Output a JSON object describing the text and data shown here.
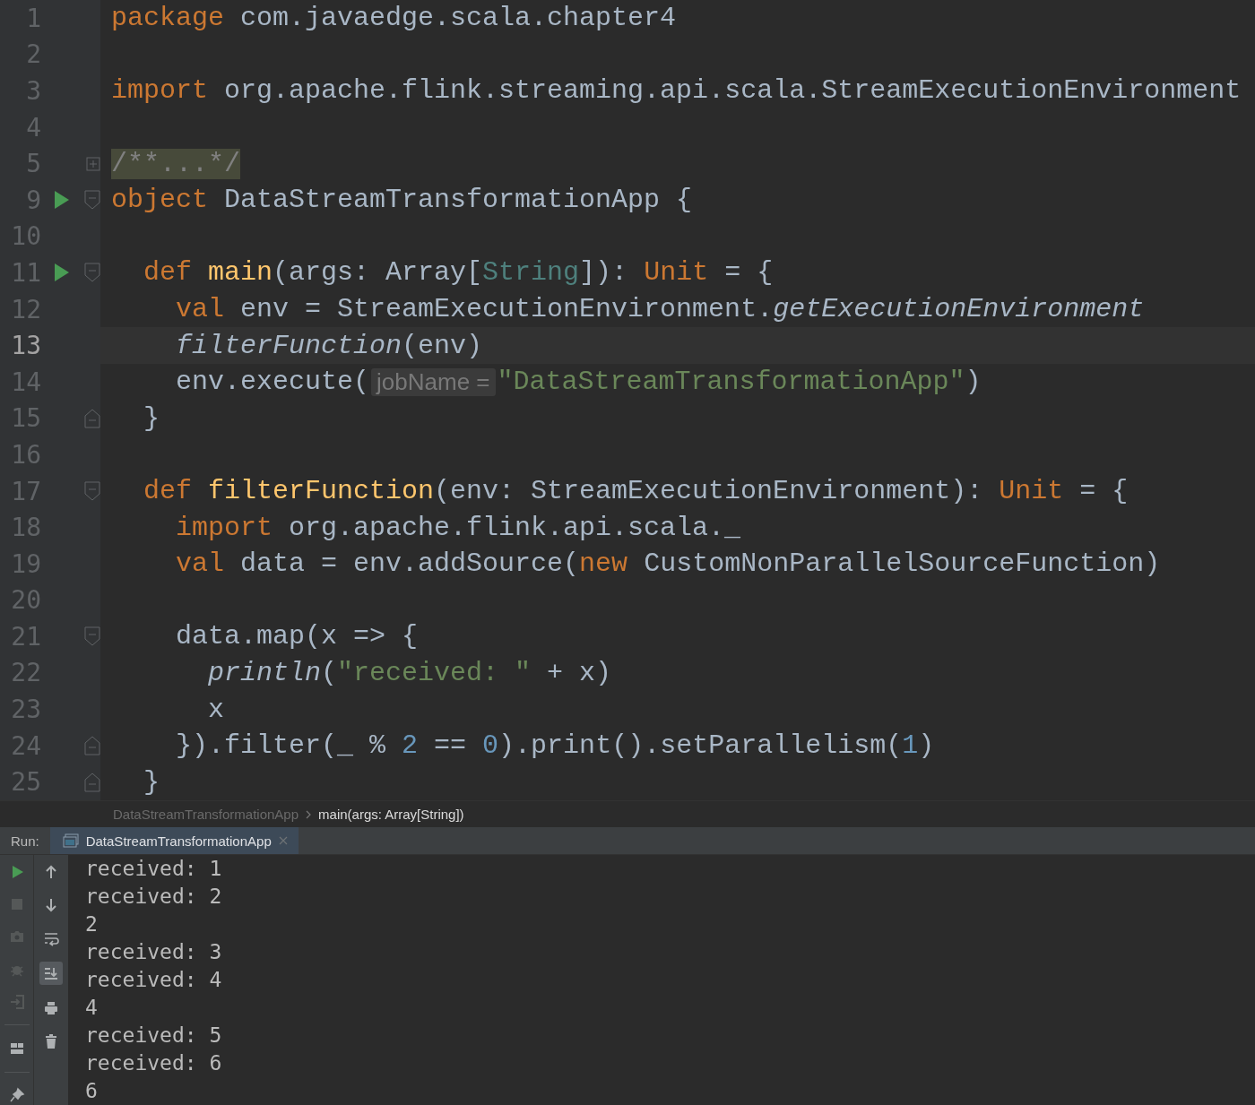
{
  "editor": {
    "lines": [
      {
        "number": "1",
        "run": false,
        "current": false,
        "tokens": [
          {
            "kind": "kw",
            "text": "package"
          },
          {
            "kind": "plain",
            "text": " com.javaedge.scala.chapter4"
          }
        ]
      },
      {
        "number": "2",
        "run": false,
        "current": false
      },
      {
        "number": "3",
        "run": false,
        "current": false,
        "tokens": [
          {
            "kind": "kw",
            "text": "import"
          },
          {
            "kind": "plain",
            "text": " org.apache.flink.streaming.api.scala.StreamExecutionEnvironment"
          }
        ]
      },
      {
        "number": "4",
        "run": false,
        "current": false
      },
      {
        "number": "5",
        "run": false,
        "current": false,
        "fold": {
          "kind": "collapsed"
        },
        "tokens": [
          {
            "kind": "folded",
            "text": "/**...*/"
          }
        ]
      },
      {
        "number": "9",
        "run": true,
        "current": false,
        "fold": {
          "kind": "start"
        },
        "tokens": [
          {
            "kind": "kw",
            "text": "object"
          },
          {
            "kind": "plain",
            "text": " DataStreamTransformationApp {"
          }
        ]
      },
      {
        "number": "10",
        "run": false,
        "current": false
      },
      {
        "number": "11",
        "run": true,
        "current": false,
        "fold": {
          "kind": "start"
        },
        "tokens": [
          {
            "kind": "kw",
            "text": "  def"
          },
          {
            "kind": "fn",
            "text": " main"
          },
          {
            "kind": "plain",
            "text": "(args: Array["
          },
          {
            "kind": "type",
            "text": "String"
          },
          {
            "kind": "plain",
            "text": "]): "
          },
          {
            "kind": "kw",
            "text": "Unit"
          },
          {
            "kind": "plain",
            "text": " = {"
          }
        ]
      },
      {
        "number": "12",
        "run": false,
        "current": false,
        "tokens": [
          {
            "kind": "kw",
            "text": "    val"
          },
          {
            "kind": "plain",
            "text": " env = StreamExecutionEnvironment."
          },
          {
            "kind": "italic",
            "text": "getExecutionEnvironment"
          }
        ]
      },
      {
        "number": "13",
        "run": false,
        "current": true,
        "tokens": [
          {
            "kind": "italic",
            "text": "    filterFunction"
          },
          {
            "kind": "plain",
            "text": "(env)"
          }
        ]
      },
      {
        "number": "14",
        "run": false,
        "current": false,
        "tokens": [
          {
            "kind": "plain",
            "text": "    env.execute("
          },
          {
            "kind": "hint",
            "text": "jobName ="
          },
          {
            "kind": "str",
            "text": "\"DataStreamTransformationApp\""
          },
          {
            "kind": "plain",
            "text": ")"
          }
        ]
      },
      {
        "number": "15",
        "run": false,
        "current": false,
        "fold": {
          "kind": "end"
        },
        "tokens": [
          {
            "kind": "plain",
            "text": "  }"
          }
        ]
      },
      {
        "number": "16",
        "run": false,
        "current": false
      },
      {
        "number": "17",
        "run": false,
        "current": false,
        "fold": {
          "kind": "start"
        },
        "tokens": [
          {
            "kind": "kw",
            "text": "  def"
          },
          {
            "kind": "fn",
            "text": " filterFunction"
          },
          {
            "kind": "plain",
            "text": "(env: StreamExecutionEnvironment): "
          },
          {
            "kind": "kw",
            "text": "Unit"
          },
          {
            "kind": "plain",
            "text": " = {"
          }
        ]
      },
      {
        "number": "18",
        "run": false,
        "current": false,
        "tokens": [
          {
            "kind": "kw",
            "text": "    import"
          },
          {
            "kind": "plain",
            "text": " org.apache.flink.api.scala._"
          }
        ]
      },
      {
        "number": "19",
        "run": false,
        "current": false,
        "tokens": [
          {
            "kind": "kw",
            "text": "    val"
          },
          {
            "kind": "plain",
            "text": " data = env.addSource("
          },
          {
            "kind": "kw",
            "text": "new"
          },
          {
            "kind": "plain",
            "text": " CustomNonParallelSourceFunction)"
          }
        ]
      },
      {
        "number": "20",
        "run": false,
        "current": false
      },
      {
        "number": "21",
        "run": false,
        "current": false,
        "fold": {
          "kind": "start"
        },
        "tokens": [
          {
            "kind": "plain",
            "text": "    data.map(x => {"
          }
        ]
      },
      {
        "number": "22",
        "run": false,
        "current": false,
        "tokens": [
          {
            "kind": "italic",
            "text": "      println"
          },
          {
            "kind": "plain",
            "text": "("
          },
          {
            "kind": "str",
            "text": "\"received: \""
          },
          {
            "kind": "plain",
            "text": " + x)"
          }
        ]
      },
      {
        "number": "23",
        "run": false,
        "current": false,
        "tokens": [
          {
            "kind": "plain",
            "text": "      x"
          }
        ]
      },
      {
        "number": "24",
        "run": false,
        "current": false,
        "fold": {
          "kind": "end"
        },
        "tokens": [
          {
            "kind": "plain",
            "text": "    }).filter(_ % "
          },
          {
            "kind": "num",
            "text": "2"
          },
          {
            "kind": "plain",
            "text": " == "
          },
          {
            "kind": "num",
            "text": "0"
          },
          {
            "kind": "plain",
            "text": ").print().setParallelism("
          },
          {
            "kind": "num",
            "text": "1"
          },
          {
            "kind": "plain",
            "text": ")"
          }
        ]
      },
      {
        "number": "25",
        "run": false,
        "current": false,
        "fold": {
          "kind": "end"
        },
        "tokens": [
          {
            "kind": "plain",
            "text": "  }"
          }
        ]
      }
    ]
  },
  "breadcrumbs": [
    {
      "label": "DataStreamTransformationApp",
      "selected": false
    },
    {
      "label": "main(args: Array[String])",
      "selected": true
    }
  ],
  "run_panel": {
    "label": "Run:",
    "tab": {
      "title": "DataStreamTransformationApp",
      "selected": true
    },
    "left_toolbar": [
      {
        "kind": "run",
        "disabled": false
      },
      {
        "kind": "stop",
        "disabled": true
      },
      {
        "kind": "camera",
        "disabled": true
      },
      {
        "kind": "bug",
        "disabled": true
      },
      {
        "kind": "exit",
        "disabled": true
      },
      {
        "kind": "separator"
      },
      {
        "kind": "layout",
        "disabled": false
      },
      {
        "kind": "separator"
      },
      {
        "kind": "pin",
        "disabled": false
      }
    ],
    "right_toolbar": [
      {
        "kind": "up",
        "selected": false
      },
      {
        "kind": "down",
        "selected": false
      },
      {
        "kind": "wrap",
        "selected": false
      },
      {
        "kind": "scroll-end",
        "selected": true
      },
      {
        "kind": "print",
        "selected": false
      },
      {
        "kind": "trash",
        "selected": false
      }
    ],
    "output": [
      "received: 1",
      "received: 2",
      "2",
      "received: 3",
      "received: 4",
      "4",
      "received: 5",
      "received: 6",
      "6"
    ]
  }
}
